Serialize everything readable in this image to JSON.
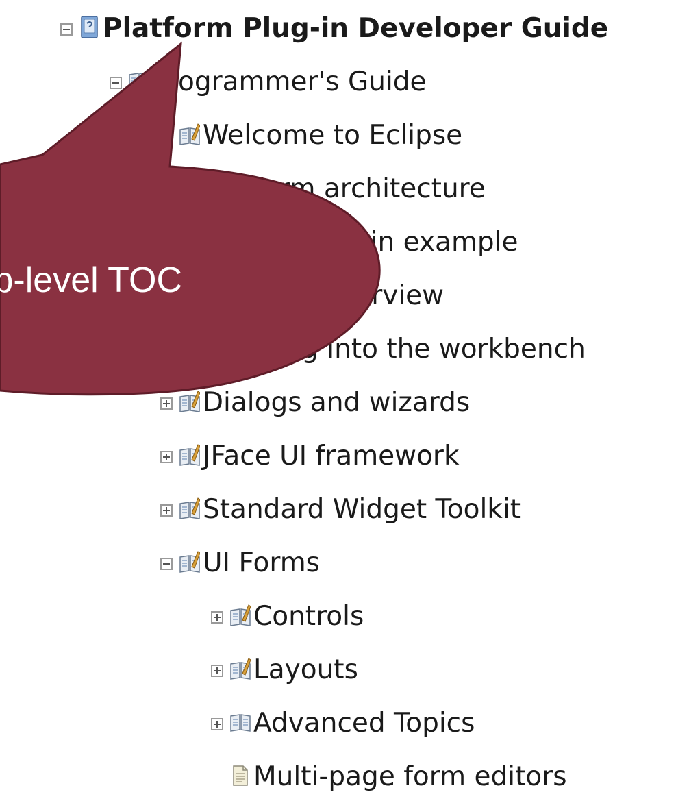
{
  "tree": {
    "root": {
      "label": "Platform Plug-in Developer Guide",
      "state": "expanded",
      "icon": "help-book-icon"
    },
    "programmers_guide": {
      "label": "Programmer's Guide",
      "state": "expanded",
      "icon": "book-icon"
    },
    "items": [
      {
        "label": "Welcome to Eclipse",
        "state": "expanded",
        "icon": "book-edit-icon"
      },
      {
        "label": "Platform architecture",
        "state": "expanded",
        "icon": "book-edit-icon"
      },
      {
        "label": "Simple plug-in example",
        "state": "expanded",
        "icon": "book-edit-icon"
      },
      {
        "label": "Runtime overview",
        "state": "expanded",
        "icon": "book-edit-icon"
      },
      {
        "label": "Plugging into the workbench",
        "state": "expanded",
        "icon": "book-edit-icon"
      },
      {
        "label": "Dialogs and wizards",
        "state": "collapsed",
        "icon": "book-edit-icon"
      },
      {
        "label": "JFace UI framework",
        "state": "collapsed",
        "icon": "book-edit-icon"
      },
      {
        "label": "Standard Widget Toolkit",
        "state": "collapsed",
        "icon": "book-edit-icon"
      },
      {
        "label": "UI Forms",
        "state": "expanded",
        "icon": "book-edit-icon"
      }
    ],
    "ui_forms_children": [
      {
        "label": "Controls",
        "state": "collapsed",
        "icon": "book-edit-icon"
      },
      {
        "label": "Layouts",
        "state": "collapsed",
        "icon": "book-edit-icon"
      },
      {
        "label": "Advanced Topics",
        "state": "collapsed",
        "icon": "book-icon"
      },
      {
        "label": "Multi-page form editors",
        "icon": "page-icon"
      }
    ]
  },
  "callout": {
    "text": "Top-level TOC",
    "fill_color": "#8a3141",
    "stroke_color": "#5e1c28"
  }
}
